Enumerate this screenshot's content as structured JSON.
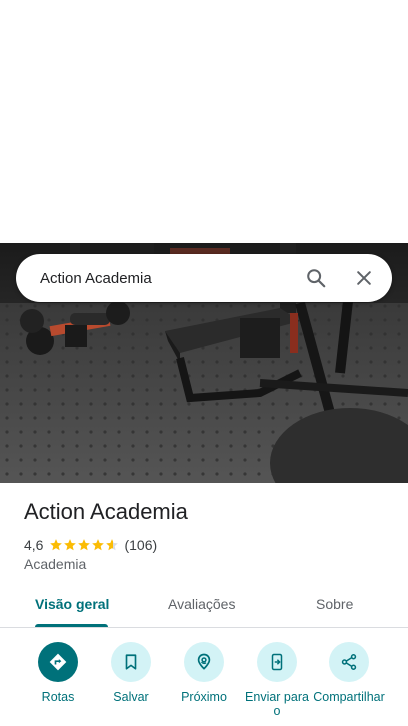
{
  "search": {
    "value": "Action Academia"
  },
  "place": {
    "name": "Action Academia",
    "rating": "4,6",
    "stars": 4.6,
    "review_count": "(106)",
    "category": "Academia"
  },
  "tabs": [
    {
      "label": "Visão geral",
      "active": true
    },
    {
      "label": "Avaliações",
      "active": false
    },
    {
      "label": "Sobre",
      "active": false
    }
  ],
  "actions": [
    {
      "label": "Rotas",
      "icon": "directions-icon"
    },
    {
      "label": "Salvar",
      "icon": "bookmark-icon"
    },
    {
      "label": "Próximo",
      "icon": "nearby-icon"
    },
    {
      "label": "Enviar para o",
      "icon": "send-to-phone-icon"
    },
    {
      "label": "Compartilhar",
      "icon": "share-icon"
    }
  ],
  "colors": {
    "accent": "#00717a",
    "accent_light": "#d3f3f6",
    "star": "#fbbc04"
  }
}
